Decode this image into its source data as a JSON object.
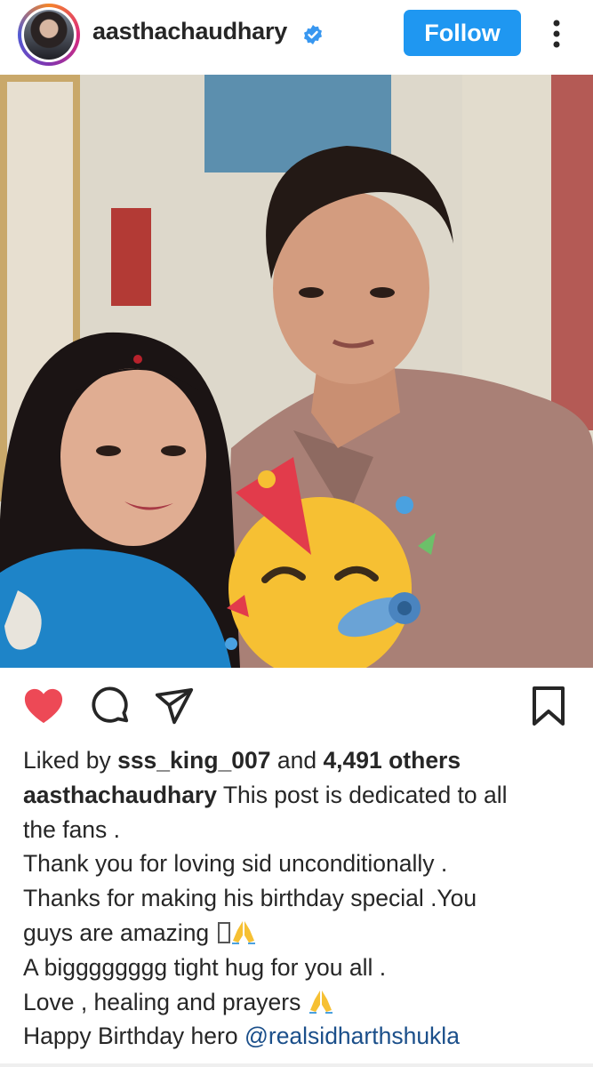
{
  "header": {
    "username": "aasthachaudhary",
    "verified": true,
    "follow_label": "Follow",
    "more_icon": "more-vertical-icon"
  },
  "post": {
    "photo_description": "photo",
    "sticker": "partying-face-emoji"
  },
  "actions": {
    "like_icon": "heart-filled-icon",
    "comment_icon": "comment-icon",
    "share_icon": "share-icon",
    "save_icon": "bookmark-icon"
  },
  "likes": {
    "prefix": "Liked by",
    "user": "sss_king_007",
    "and": "and",
    "count": "4,491 others"
  },
  "caption": {
    "author": "aasthachaudhary",
    "line1": "This post is dedicated to all",
    "line2": "the fans .",
    "line3": "Thank you for loving sid unconditionally .",
    "line4": "Thanks for making his birthday special .You",
    "line5": "guys are amazing",
    "line6": "A bigggggggg tight hug for you all .",
    "line7": "Love , healing and prayers",
    "line8": "Happy Birthday hero",
    "mention": "@realsidharthshukla"
  },
  "colors": {
    "follow_blue": "#1f97f1",
    "heart_red": "#ed4956",
    "mention_blue": "#1b4f8a",
    "text": "#262626"
  }
}
